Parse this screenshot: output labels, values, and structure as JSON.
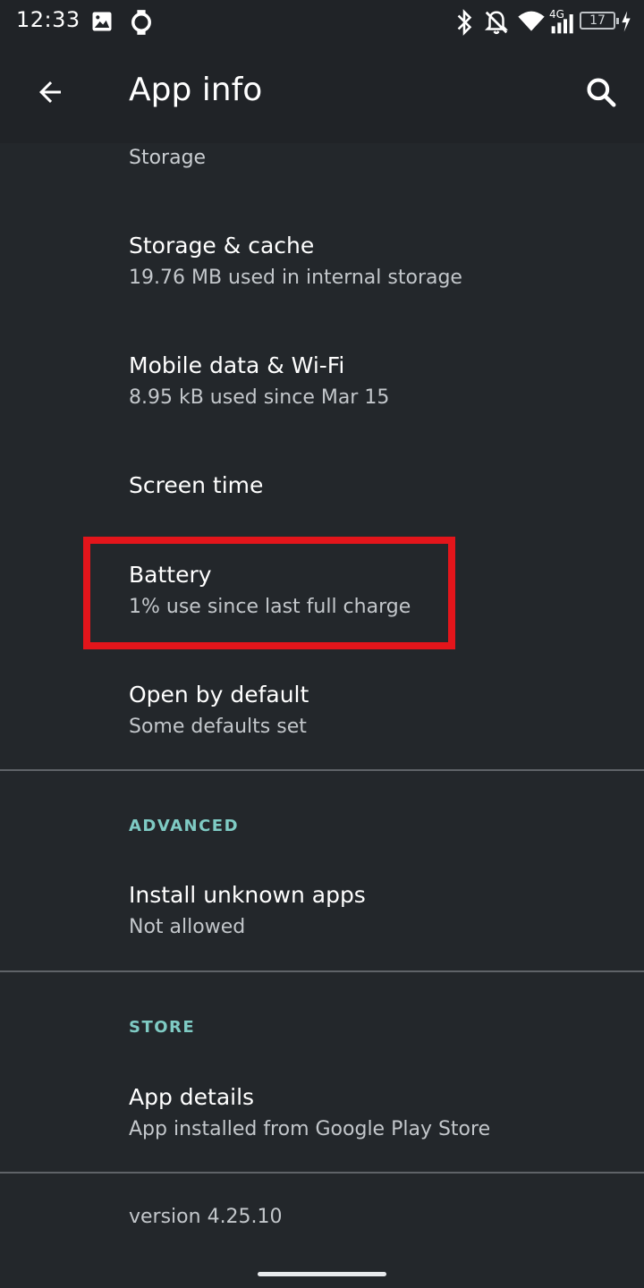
{
  "status_bar": {
    "time": "12:33",
    "battery_level": "17",
    "network_type": "4G",
    "icons": [
      "image-icon",
      "watch-icon",
      "bluetooth-icon",
      "notifications-off-icon",
      "wifi-icon",
      "cellular-signal-icon",
      "battery-icon",
      "charging-icon"
    ]
  },
  "app_bar": {
    "title": "App info",
    "back_icon": "arrow-back-icon",
    "search_icon": "search-icon"
  },
  "sections": {
    "storage_label": "Storage",
    "storage_cache": {
      "title": "Storage & cache",
      "summary": "19.76 MB used in internal storage"
    },
    "mobile_data": {
      "title": "Mobile data & Wi-Fi",
      "summary": "8.95 kB used since Mar 15"
    },
    "screen_time": {
      "title": "Screen time"
    },
    "battery": {
      "title": "Battery",
      "summary": "1% use since last full charge"
    },
    "open_by_default": {
      "title": "Open by default",
      "summary": "Some defaults set"
    },
    "advanced_header": "ADVANCED",
    "install_unknown": {
      "title": "Install unknown apps",
      "summary": "Not allowed"
    },
    "store_header": "STORE",
    "app_details": {
      "title": "App details",
      "summary": "App installed from Google Play Store"
    },
    "version": "version 4.25.10"
  },
  "colors": {
    "background": "#23272b",
    "accent": "#7fcbc4",
    "highlight": "#e3151b"
  }
}
